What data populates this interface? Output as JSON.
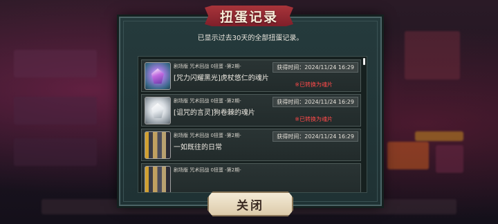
{
  "dialog": {
    "title": "扭蛋记录",
    "subtitle": "已显示过去30天的全部扭蛋记录。",
    "close_label": "关闭"
  },
  "records": [
    {
      "banner": "剧场版 咒术回战 0扭蛋 -第2期-",
      "item": "[咒力闪耀黑光]虎杖悠仁的魂片",
      "time": "获得时间：2024/11/24 16:29",
      "converted": "※已转换为魂片",
      "icon": "purple-gem-icon"
    },
    {
      "banner": "剧场版 咒术回战 0扭蛋 -第2期-",
      "item": "[诅咒的言灵]狗卷棘的魂片",
      "time": "获得时间：2024/11/24 16:29",
      "converted": "※已转换为魂片",
      "icon": "white-gem-icon"
    },
    {
      "banner": "剧场版 咒术回战 0扭蛋 -第2期-",
      "item": "一如既往的日常",
      "time": "获得时间：2024/11/24 16:29",
      "converted": "",
      "icon": "scene-card-icon"
    },
    {
      "banner": "剧场版 咒术回战 0扭蛋 -第2期-",
      "item": "",
      "time": "",
      "converted": "",
      "icon": "scene-card-icon"
    }
  ],
  "colors": {
    "panel": "#253a3c",
    "accent_red": "#a8343a",
    "converted_text": "#ff4a4a"
  }
}
